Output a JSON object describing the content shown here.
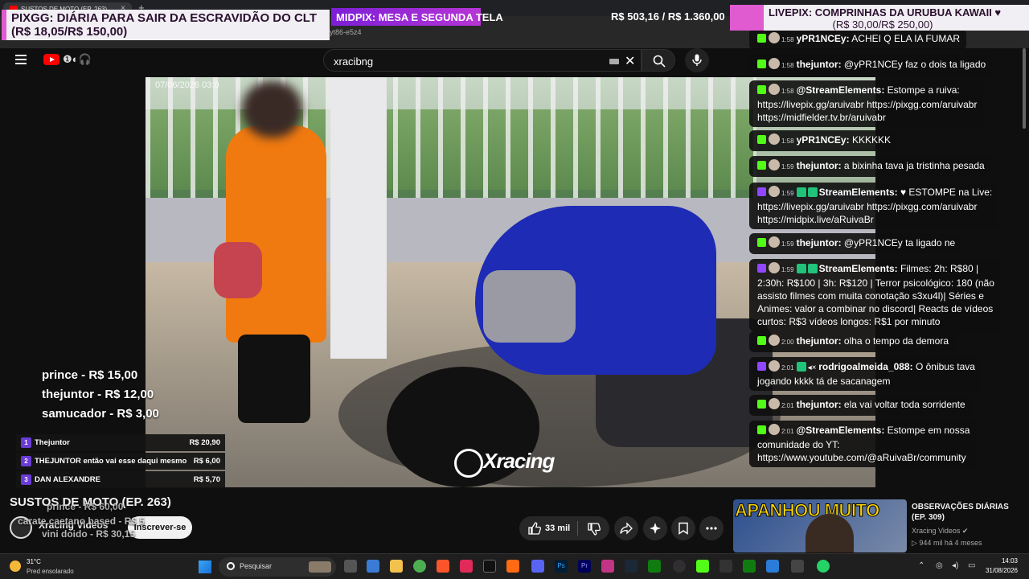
{
  "browser": {
    "tab_title": "SUSTOS DE MOTO (EP. 263)",
    "url_fragment": "yt86-e5z4"
  },
  "overlays": {
    "pixgg": {
      "title": "PIXGG: DIÁRIA PARA SAIR DA ESCRAVIDÃO DO CLT",
      "amount": "(R$ 18,05/R$ 150,00)"
    },
    "midpix": {
      "title": "MIDPIX: MESA E SEGUNDA TELA",
      "amount": "R$ 503,16 / R$ 1.360,00"
    },
    "livepix": {
      "title": "LIVEPIX: COMPRINHAS DA URUBUA KAWAII ♥",
      "amount": "(R$ 30,00/R$ 250,00)"
    },
    "top_donors": [
      {
        "label": "prince - R$ 15,00"
      },
      {
        "label": "thejuntor - R$ 12,00"
      },
      {
        "label": "samucador - R$ 3,00"
      }
    ],
    "ranking": [
      {
        "pos": "1",
        "name": "Thejuntor",
        "amount": "R$ 20,90"
      },
      {
        "pos": "2",
        "name": "THEJUNTOR então vai esse daqui mesmo",
        "amount": "R$ 6,00"
      },
      {
        "pos": "3",
        "name": "DAN ALEXANDRE",
        "amount": "R$ 5,70"
      }
    ],
    "ghost_donors": {
      "a": "prince - R$ 60,00",
      "b": "carate caetano based - R$ 5",
      "c": "vini doido - R$ 30,15"
    }
  },
  "masthead": {
    "search_value": "xracibng"
  },
  "video": {
    "date_stamp": "07/06/2026  03:0",
    "watermark": "Xracing"
  },
  "watch": {
    "title": "SUSTOS DE MOTO (EP. 263)",
    "channel": "Xracing Videos",
    "subscribe_label": "Inscrever-se",
    "likes": "33 mil"
  },
  "related": {
    "thumb_text": "APANHOU MUITO",
    "title": "OBSERVAÇÕES DIÁRIAS (EP. 309)",
    "channel": "Xracing Videos",
    "meta": "944 mil  há 4 meses"
  },
  "chat": [
    {
      "time": "1:58",
      "user": "yPR1NCEy:",
      "text": "ACHEI Q ELA IA FUMAR"
    },
    {
      "time": "1:58",
      "user": "thejuntor:",
      "text": "@yPR1NCEy faz o dois ta ligado"
    },
    {
      "time": "1:58",
      "user": "@StreamElements:",
      "text": "Estompe a ruiva:",
      "line2": "https://livepix.gg/aruivabr https://pixgg.com/aruivabr",
      "line3": "https://midfielder.tv.br/aruivabr"
    },
    {
      "time": "1:58",
      "user": "yPR1NCEy:",
      "text": "KKKKKK"
    },
    {
      "time": "1:59",
      "user": "thejuntor:",
      "text": "a bixinha tava ja tristinha pesada"
    },
    {
      "time": "1:59",
      "user": "StreamElements:",
      "text": "♥ ESTOMPE na Live:",
      "line2": "https://livepix.gg/aruivabr https://pixgg.com/aruivabr",
      "line3": "https://midpix.live/aRuivaBr"
    },
    {
      "time": "1:59",
      "user": "thejuntor:",
      "text": "@yPR1NCEy ta ligado ne"
    },
    {
      "time": "1:59",
      "user": "StreamElements:",
      "text": "Filmes: 2h: R$80 |",
      "line2": "2:30h: R$100 | 3h: R$120 | Terror psicológico: 180 (não",
      "line3": "assisto filmes com muita conotação s3xu4l)| Séries e",
      "line4": "Animes: valor a combinar no discord| Reacts de vídeos",
      "line5": "curtos: R$3 vídeos longos: R$1 por minuto"
    },
    {
      "time": "2:00",
      "user": "thejuntor:",
      "text": "olha o tempo da demora"
    },
    {
      "time": "2:01",
      "user": "rodrigoalmeida_088:",
      "text": "O ônibus tava",
      "line2": "jogando kkkk tá de sacanagem"
    },
    {
      "time": "2:01",
      "user": "thejuntor:",
      "text": "ela vai voltar toda sorridente"
    },
    {
      "time": "2:01",
      "user": "@StreamElements:",
      "text": "Estompe em nossa",
      "line2": "comunidade do YT:",
      "line3": "https://www.youtube.com/@aRuivaBr/community"
    }
  ],
  "taskbar": {
    "temp": "31°C",
    "weather": "Pred ensolarado",
    "search_placeholder": "Pesquisar",
    "time": "14:03",
    "date": "31/08/2026"
  }
}
